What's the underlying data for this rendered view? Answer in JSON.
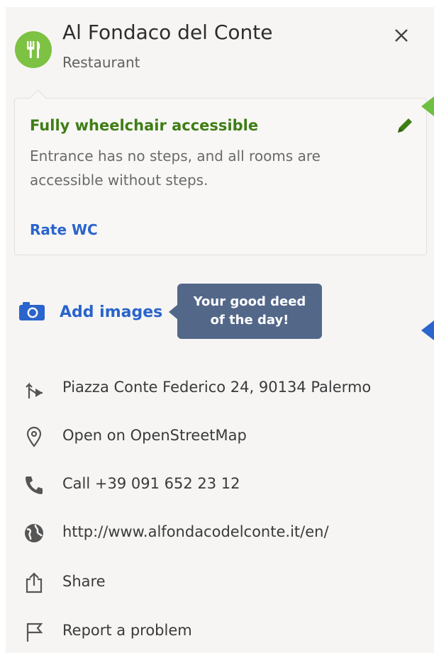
{
  "place": {
    "name": "Al Fondaco del Conte",
    "category": "Restaurant"
  },
  "accessibility": {
    "title": "Fully wheelchair accessible",
    "description": "Entrance has no steps, and all rooms are accessible without steps.",
    "rate_link": "Rate WC"
  },
  "add_images": {
    "label": "Add images",
    "tooltip_line1": "Your good deed",
    "tooltip_line2": "of the day!"
  },
  "details": {
    "address": "Piazza Conte Federico 24, 90134 Palermo",
    "osm": "Open on OpenStreetMap",
    "phone": "Call +39 091 652 23 12",
    "website": "http://www.alfondacodelconte.it/en/",
    "share": "Share",
    "report": "Report a problem"
  },
  "colors": {
    "accessible_green": "#3f7d15",
    "category_green": "#7dc243",
    "link_blue": "#2a64cc",
    "tooltip_bg": "#536789"
  },
  "icons": {
    "category": "restaurant-fork-knife-icon",
    "close": "close-icon",
    "edit": "pencil-icon",
    "camera": "camera-icon",
    "address": "directions-arrow-icon",
    "osm": "map-pin-icon",
    "phone": "phone-icon",
    "website": "globe-icon",
    "share": "share-icon",
    "report": "flag-icon"
  }
}
